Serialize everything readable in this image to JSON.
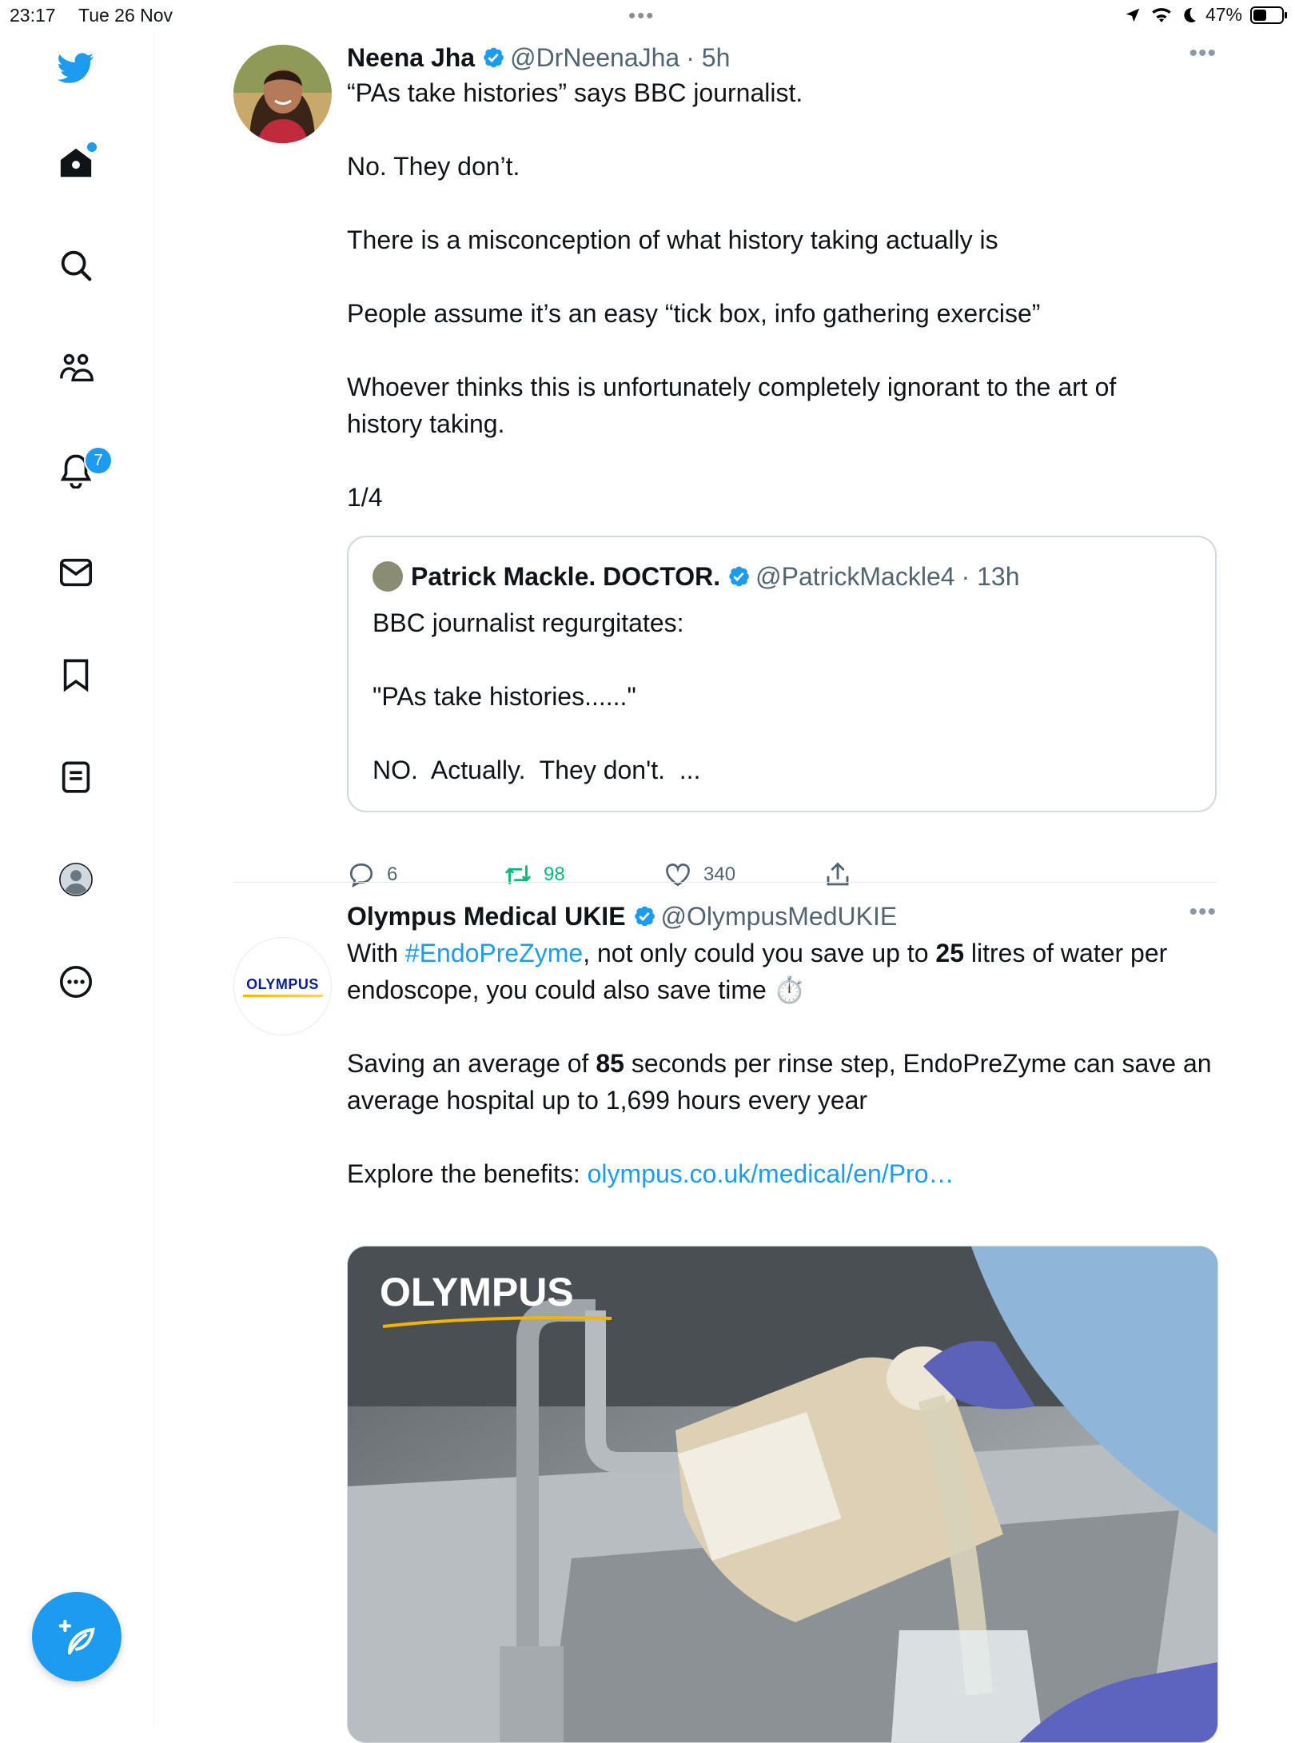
{
  "status_bar": {
    "time": "23:17",
    "date": "Tue 26 Nov",
    "battery": "47%",
    "battery_level": 0.47
  },
  "sidebar": {
    "items": [
      {
        "icon": "twitter-logo-icon"
      },
      {
        "icon": "home-icon",
        "dot": true
      },
      {
        "icon": "search-icon"
      },
      {
        "icon": "communities-icon"
      },
      {
        "icon": "notifications-icon",
        "badge": "7"
      },
      {
        "icon": "messages-icon"
      },
      {
        "icon": "bookmarks-icon"
      },
      {
        "icon": "lists-icon"
      },
      {
        "icon": "profile-icon"
      },
      {
        "icon": "more-icon"
      }
    ],
    "compose_icon": "compose-icon"
  },
  "tweets": [
    {
      "name": "Neena Jha",
      "handle": "@DrNeenaJha",
      "time": "· 5h",
      "text": [
        "“PAs take histories” says BBC journalist.",
        "No. They don’t.",
        "There is a misconception of what history taking actually is",
        "People assume it’s an easy “tick box, info gathering exercise”",
        "Whoever thinks this is unfortunately completely ignorant to the art of history taking.",
        "1/4"
      ],
      "quote": {
        "name": "Patrick Mackle. DOCTOR.",
        "handle": "@PatrickMackle4",
        "time": "· 13h",
        "text": [
          "BBC journalist regurgitates:",
          "\"PAs take histories......\"",
          "NO.  Actually.  They don't.  ..."
        ]
      },
      "actions": {
        "replies": "6",
        "retweets": "98",
        "likes": "340"
      },
      "colors": {
        "retweet": "#00ba7c"
      }
    },
    {
      "name": "Olympus Medical UKIE",
      "handle": "@OlympusMedUKIE",
      "avatar_text": "OLYMPUS",
      "text_p1_a": "With ",
      "hashtag": "#EndoPreZyme",
      "text_p1_b": ", not only could you save up to ",
      "bold_25": "25",
      "text_p1_c": " litres of water per endoscope, you could also save time ⏱️",
      "text_p2_a": "Saving an average of ",
      "bold_85": "85",
      "text_p2_b": " seconds per rinse step, EndoPreZyme can save an average hospital up to 1,699 hours every year",
      "text_p3_a": "Explore the benefits: ",
      "link": "olympus.co.uk/medical/en/Pro…",
      "media_brand": "OLYMPUS"
    }
  ],
  "colors": {
    "accent": "#1d9bf0",
    "text": "#0f1419",
    "secondary": "#536471"
  }
}
